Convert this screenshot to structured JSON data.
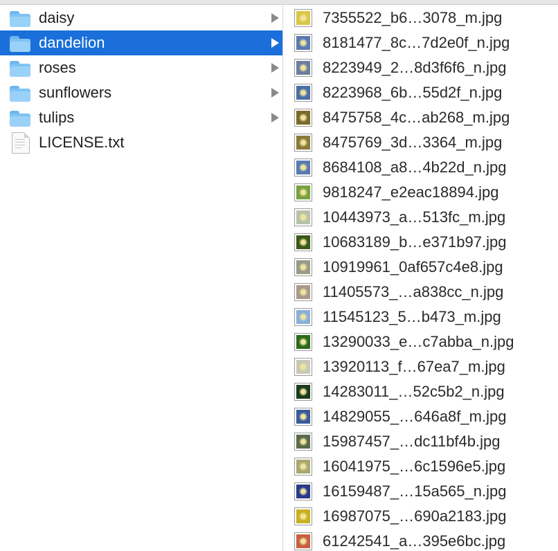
{
  "folders": [
    {
      "label": "daisy",
      "icon": "folder-icon",
      "selected": false
    },
    {
      "label": "dandelion",
      "icon": "folder-icon",
      "selected": true
    },
    {
      "label": "roses",
      "icon": "folder-icon",
      "selected": false
    },
    {
      "label": "sunflowers",
      "icon": "folder-icon",
      "selected": false
    },
    {
      "label": "tulips",
      "icon": "folder-icon",
      "selected": false
    }
  ],
  "license": {
    "label": "LICENSE.txt",
    "icon": "document-icon"
  },
  "files": [
    {
      "name": "7355522_b6…3078_m.jpg",
      "thumb_color": "#d8c84a"
    },
    {
      "name": "8181477_8c…7d2e0f_n.jpg",
      "thumb_color": "#5a7ab0"
    },
    {
      "name": "8223949_2…8d3f6f6_n.jpg",
      "thumb_color": "#6b7f9a"
    },
    {
      "name": "8223968_6b…55d2f_n.jpg",
      "thumb_color": "#4a6ea6"
    },
    {
      "name": "8475758_4c…ab268_m.jpg",
      "thumb_color": "#7a6a2a"
    },
    {
      "name": "8475769_3d…3364_m.jpg",
      "thumb_color": "#8a7a3a"
    },
    {
      "name": "8684108_a8…4b22d_n.jpg",
      "thumb_color": "#5a7ab0"
    },
    {
      "name": "9818247_e2eac18894.jpg",
      "thumb_color": "#7aa040"
    },
    {
      "name": "10443973_a…513fc_m.jpg",
      "thumb_color": "#b8c2a8"
    },
    {
      "name": "10683189_b…e371b97.jpg",
      "thumb_color": "#3a5a1a"
    },
    {
      "name": "10919961_0af657c4e8.jpg",
      "thumb_color": "#9a9a8a"
    },
    {
      "name": "11405573_…a838cc_n.jpg",
      "thumb_color": "#a89a8a"
    },
    {
      "name": "11545123_5…b473_m.jpg",
      "thumb_color": "#8ab0d8"
    },
    {
      "name": "13290033_e…c7abba_n.jpg",
      "thumb_color": "#2a6a1a"
    },
    {
      "name": "13920113_f…67ea7_m.jpg",
      "thumb_color": "#c8c8b8"
    },
    {
      "name": "14283011_…52c5b2_n.jpg",
      "thumb_color": "#1a3a1a"
    },
    {
      "name": "14829055_…646a8f_m.jpg",
      "thumb_color": "#3a5a9a"
    },
    {
      "name": "15987457_…dc11bf4b.jpg",
      "thumb_color": "#5a6a4a"
    },
    {
      "name": "16041975_…6c1596e5.jpg",
      "thumb_color": "#a8a870"
    },
    {
      "name": "16159487_…15a565_n.jpg",
      "thumb_color": "#2a3a8a"
    },
    {
      "name": "16987075_…690a2183.jpg",
      "thumb_color": "#c8b020"
    },
    {
      "name": "61242541_a…395e6bc.jpg",
      "thumb_color": "#c86040"
    }
  ],
  "colors": {
    "selection": "#1a6fdb",
    "folder": "#7fc3f5"
  }
}
